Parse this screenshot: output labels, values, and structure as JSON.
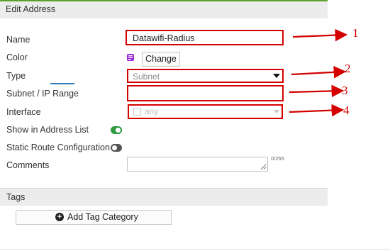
{
  "header": {
    "title": "Edit Address"
  },
  "form": {
    "name_label": "Name",
    "name_value": "Datawifi-Radius",
    "color_label": "Color",
    "color_change_label": "Change",
    "type_label": "Type",
    "type_value": "Subnet",
    "subnet_label": "Subnet / IP Range",
    "subnet_value": "",
    "interface_label": "Interface",
    "interface_value": "any",
    "show_in_list_label": "Show in Address List",
    "show_in_list_on": true,
    "static_route_label": "Static Route Configuration",
    "static_route_on": false,
    "comments_label": "Comments",
    "comments_value": "",
    "comments_counter": "0/255"
  },
  "tags": {
    "title": "Tags",
    "add_label": "Add Tag Category"
  },
  "annotations": {
    "n1": "1",
    "n2": "2",
    "n3": "3",
    "n4": "4"
  },
  "colors": {
    "accent_green": "#2e9b3e",
    "annotation_red": "#d40000",
    "palette_purple": "#9b2bd6",
    "tab_blue": "#2f7fc1"
  }
}
